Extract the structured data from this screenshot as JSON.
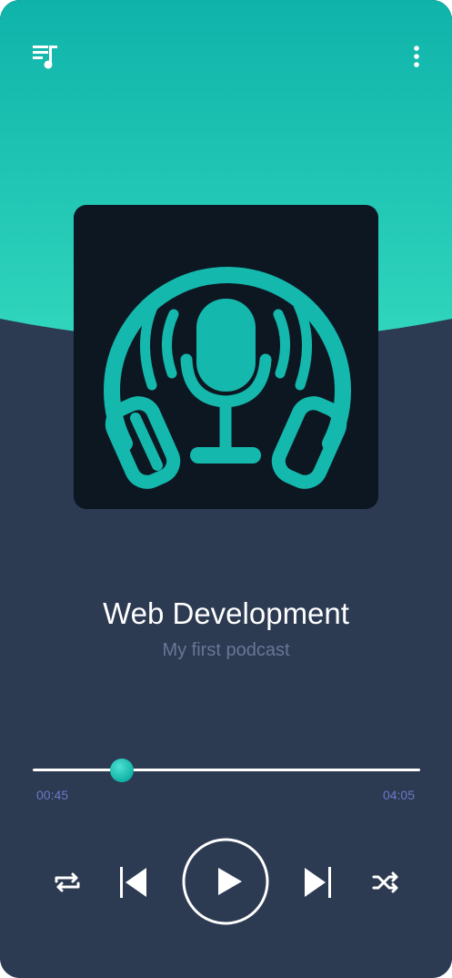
{
  "episode": {
    "title": "Web Development",
    "subtitle": "My first podcast"
  },
  "playback": {
    "current_time": "00:45",
    "total_time": "04:05",
    "progress": 0.23
  },
  "icons": {
    "top_left": "playlist-music-icon",
    "top_right": "more-vertical-icon",
    "cover": "podcast-headphones-microphone-icon",
    "controls": [
      "repeat-icon",
      "skip-previous-icon",
      "play-icon",
      "skip-next-icon",
      "shuffle-icon"
    ]
  },
  "colors": {
    "accent": "#14b8ad",
    "header_top": "#0fb3a9",
    "header_bottom": "#2ed3bc",
    "background": "#2c3a52",
    "cover_bg": "#0d1722",
    "subtitle": "#6a7696",
    "time": "#6a7ac6"
  }
}
